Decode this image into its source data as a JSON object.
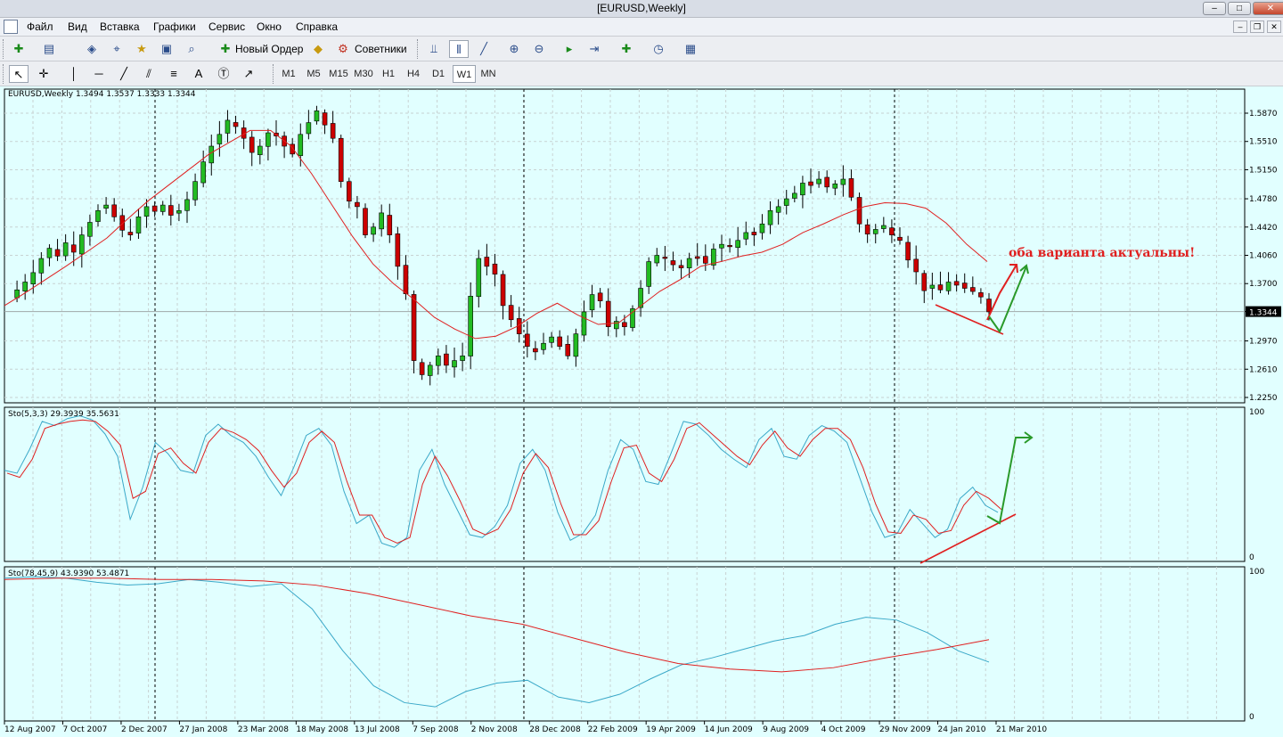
{
  "window": {
    "title": "[EURUSD,Weekly]"
  },
  "menu": [
    "Файл",
    "Вид",
    "Вставка",
    "Графики",
    "Сервис",
    "Окно",
    "Справка"
  ],
  "toolbar": {
    "new_order": "Новый Ордер",
    "advisors": "Советники"
  },
  "timeframes": [
    "M1",
    "M5",
    "M15",
    "M30",
    "H1",
    "H4",
    "D1",
    "W1",
    "MN"
  ],
  "active_timeframe": "W1",
  "chart": {
    "header": "EURUSD,Weekly  1.3494 1.3537 1.3333 1.3344",
    "price_labels": [
      "1.5870",
      "1.5510",
      "1.5150",
      "1.4780",
      "1.4420",
      "1.4060",
      "1.3700",
      "1.3344",
      "1.2970",
      "1.2610",
      "1.2250"
    ],
    "current_price": "1.3344",
    "annotation": "оба варианта актуальны!",
    "sto1_header": "Sto(5,3,3) 29.3939 35.5631",
    "sto2_header": "Sto(78,45,9) 43.9390 53.4871",
    "osc_top": "100",
    "osc_bottom": "0",
    "date_labels": [
      "12 Aug 2007",
      "7 Oct 2007",
      "2 Dec 2007",
      "27 Jan 2008",
      "23 Mar 2008",
      "18 May 2008",
      "13 Jul 2008",
      "7 Sep 2008",
      "2 Nov 2008",
      "28 Dec 2008",
      "22 Feb 2009",
      "19 Apr 2009",
      "14 Jun 2009",
      "9 Aug 2009",
      "4 Oct 2009",
      "29 Nov 2009",
      "24 Jan 2010",
      "21 Mar 2010"
    ],
    "colors": {
      "background": "#e1ffff",
      "bull": "#22bb22",
      "bear": "#cc0000",
      "ma": "#e02020",
      "sto_main": "#3aa8c8",
      "sto_signal": "#e02020"
    }
  },
  "chart_data": {
    "type": "candlestick",
    "ylim": [
      1.225,
      1.587
    ],
    "close_path": [
      1.352,
      1.362,
      1.372,
      1.384,
      1.402,
      1.415,
      1.405,
      1.422,
      1.41,
      1.432,
      1.448,
      1.463,
      1.47,
      1.455,
      1.438,
      1.432,
      1.455,
      1.468,
      1.462,
      1.47,
      1.457,
      1.463,
      1.477,
      1.5,
      1.525,
      1.545,
      1.56,
      1.578,
      1.57,
      1.555,
      1.537,
      1.545,
      1.562,
      1.558,
      1.545,
      1.535,
      1.56,
      1.575,
      1.59,
      1.572,
      1.555,
      1.5,
      1.475,
      1.468,
      1.432,
      1.442,
      1.46,
      1.432,
      1.392,
      1.357,
      1.272,
      1.254,
      1.266,
      1.278,
      1.266,
      1.272,
      1.278,
      1.354,
      1.402,
      1.392,
      1.382,
      1.342,
      1.324,
      1.306,
      1.29,
      1.283,
      1.294,
      1.302,
      1.29,
      1.278,
      1.306,
      1.334,
      1.356,
      1.348,
      1.315,
      1.322,
      1.315,
      1.338,
      1.364,
      1.398,
      1.406,
      1.402,
      1.394,
      1.39,
      1.402,
      1.402,
      1.396,
      1.414,
      1.42,
      1.418,
      1.425,
      1.435,
      1.432,
      1.446,
      1.463,
      1.468,
      1.478,
      1.485,
      1.498,
      1.495,
      1.503,
      1.493,
      1.497,
      1.503,
      1.48,
      1.446,
      1.433,
      1.439,
      1.444,
      1.432,
      1.425,
      1.4,
      1.385,
      1.361,
      1.368,
      1.362,
      1.372,
      1.368,
      1.364,
      1.36,
      1.353,
      1.334
    ],
    "ma_path": [
      1.342,
      1.358,
      1.375,
      1.392,
      1.41,
      1.428,
      1.452,
      1.475,
      1.495,
      1.515,
      1.535,
      1.55,
      1.565,
      1.565,
      1.545,
      1.51,
      1.47,
      1.43,
      1.395,
      1.37,
      1.35,
      1.327,
      1.312,
      1.3,
      1.303,
      1.315,
      1.332,
      1.345,
      1.33,
      1.318,
      1.32,
      1.34,
      1.36,
      1.375,
      1.392,
      1.398,
      1.405,
      1.41,
      1.42,
      1.435,
      1.446,
      1.458,
      1.468,
      1.473,
      1.472,
      1.466,
      1.447,
      1.42,
      1.398
    ],
    "sto_fast_main": [
      60,
      58,
      75,
      95,
      92,
      97,
      99,
      96,
      86,
      70,
      25,
      48,
      80,
      72,
      60,
      58,
      85,
      93,
      85,
      80,
      70,
      55,
      42,
      62,
      85,
      90,
      78,
      45,
      22,
      28,
      8,
      5,
      12,
      60,
      75,
      50,
      32,
      14,
      12,
      20,
      35,
      65,
      75,
      60,
      30,
      10,
      15,
      28,
      60,
      82,
      75,
      52,
      50,
      72,
      95,
      93,
      85,
      75,
      68,
      62,
      82,
      90,
      70,
      68,
      85,
      92,
      88,
      80,
      55,
      30,
      12,
      15,
      32,
      22,
      12,
      18,
      40,
      48,
      35,
      30
    ],
    "sto_fast_signal": [
      58,
      55,
      68,
      90,
      93,
      95,
      96,
      95,
      88,
      78,
      40,
      45,
      72,
      76,
      65,
      58,
      80,
      90,
      87,
      82,
      74,
      60,
      48,
      58,
      80,
      88,
      80,
      52,
      28,
      28,
      12,
      8,
      12,
      50,
      70,
      56,
      38,
      18,
      14,
      18,
      32,
      58,
      72,
      62,
      36,
      14,
      14,
      24,
      52,
      76,
      78,
      58,
      52,
      68,
      90,
      94,
      86,
      78,
      70,
      64,
      78,
      88,
      76,
      70,
      82,
      90,
      90,
      82,
      62,
      36,
      16,
      15,
      28,
      25,
      15,
      17,
      35,
      45,
      40,
      32
    ],
    "sto_slow_main": [
      97,
      98,
      97,
      94,
      92,
      93,
      96,
      94,
      91,
      93,
      75,
      45,
      20,
      8,
      5,
      16,
      22,
      24,
      12,
      8,
      14,
      25,
      35,
      40,
      46,
      52,
      56,
      64,
      69,
      67,
      58,
      45,
      37
    ],
    "sto_slow_signal": [
      96,
      97,
      97,
      96,
      96,
      95,
      92,
      86,
      78,
      70,
      64,
      54,
      44,
      36,
      32,
      30,
      33,
      40,
      46,
      53
    ]
  }
}
